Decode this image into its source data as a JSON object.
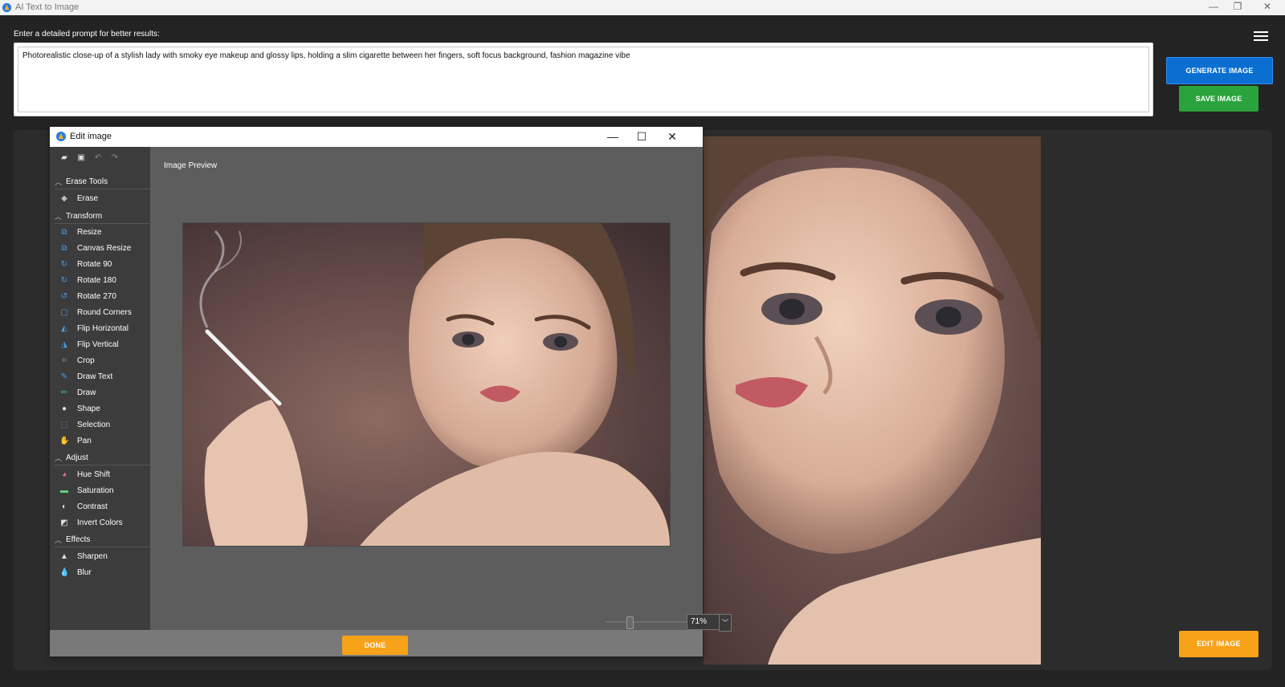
{
  "app": {
    "title": "AI Text to Image",
    "controls": {
      "minimize": "—",
      "restore": "❐",
      "close": "✕"
    }
  },
  "prompt": {
    "label": "Enter a detailed prompt for better results:",
    "value": "Photorealistic close-up of a stylish lady with smoky eye makeup and glossy lips, holding a slim cigarette between her fingers, soft focus background, fashion magazine vibe"
  },
  "buttons": {
    "generate": "GENERATE IMAGE",
    "save": "SAVE IMAGE",
    "edit": "EDIT IMAGE"
  },
  "colors": {
    "generate": "#0a6fd0",
    "save": "#2ba33d",
    "edit": "#f7a218",
    "done": "#f7a218"
  },
  "editor": {
    "title": "Edit image",
    "controls": {
      "minimize": "—",
      "maximize": "☐",
      "close": "✕"
    },
    "toolbar": [
      "open-icon",
      "save-icon",
      "undo-icon",
      "redo-icon"
    ],
    "groups": [
      {
        "label": "Erase Tools",
        "items": [
          {
            "label": "Erase",
            "icon": "eraser-icon"
          }
        ]
      },
      {
        "label": "Transform",
        "items": [
          {
            "label": "Resize",
            "icon": "resize-icon"
          },
          {
            "label": "Canvas Resize",
            "icon": "canvas-resize-icon"
          },
          {
            "label": "Rotate 90",
            "icon": "rotate-icon"
          },
          {
            "label": "Rotate 180",
            "icon": "rotate-icon"
          },
          {
            "label": "Rotate 270",
            "icon": "rotate-icon"
          },
          {
            "label": "Round Corners",
            "icon": "round-corners-icon"
          },
          {
            "label": "Flip Horizontal",
            "icon": "flip-horizontal-icon"
          },
          {
            "label": "Flip Vertical",
            "icon": "flip-vertical-icon"
          },
          {
            "label": "Crop",
            "icon": "crop-icon"
          },
          {
            "label": "Draw Text",
            "icon": "draw-text-icon"
          },
          {
            "label": "Draw",
            "icon": "pen-icon"
          },
          {
            "label": "Shape",
            "icon": "shape-icon"
          },
          {
            "label": "Selection",
            "icon": "selection-icon"
          },
          {
            "label": "Pan",
            "icon": "hand-icon"
          }
        ]
      },
      {
        "label": "Adjust",
        "items": [
          {
            "label": "Hue Shift",
            "icon": "hue-icon"
          },
          {
            "label": "Saturation",
            "icon": "saturation-icon"
          },
          {
            "label": "Contrast",
            "icon": "contrast-icon"
          },
          {
            "label": "Invert Colors",
            "icon": "invert-icon"
          }
        ]
      },
      {
        "label": "Effects",
        "items": [
          {
            "label": "Sharpen",
            "icon": "sharpen-icon"
          },
          {
            "label": "Blur",
            "icon": "blur-icon"
          }
        ]
      }
    ],
    "preview_label": "Image Preview",
    "zoom": "71%",
    "done": "DONE"
  }
}
